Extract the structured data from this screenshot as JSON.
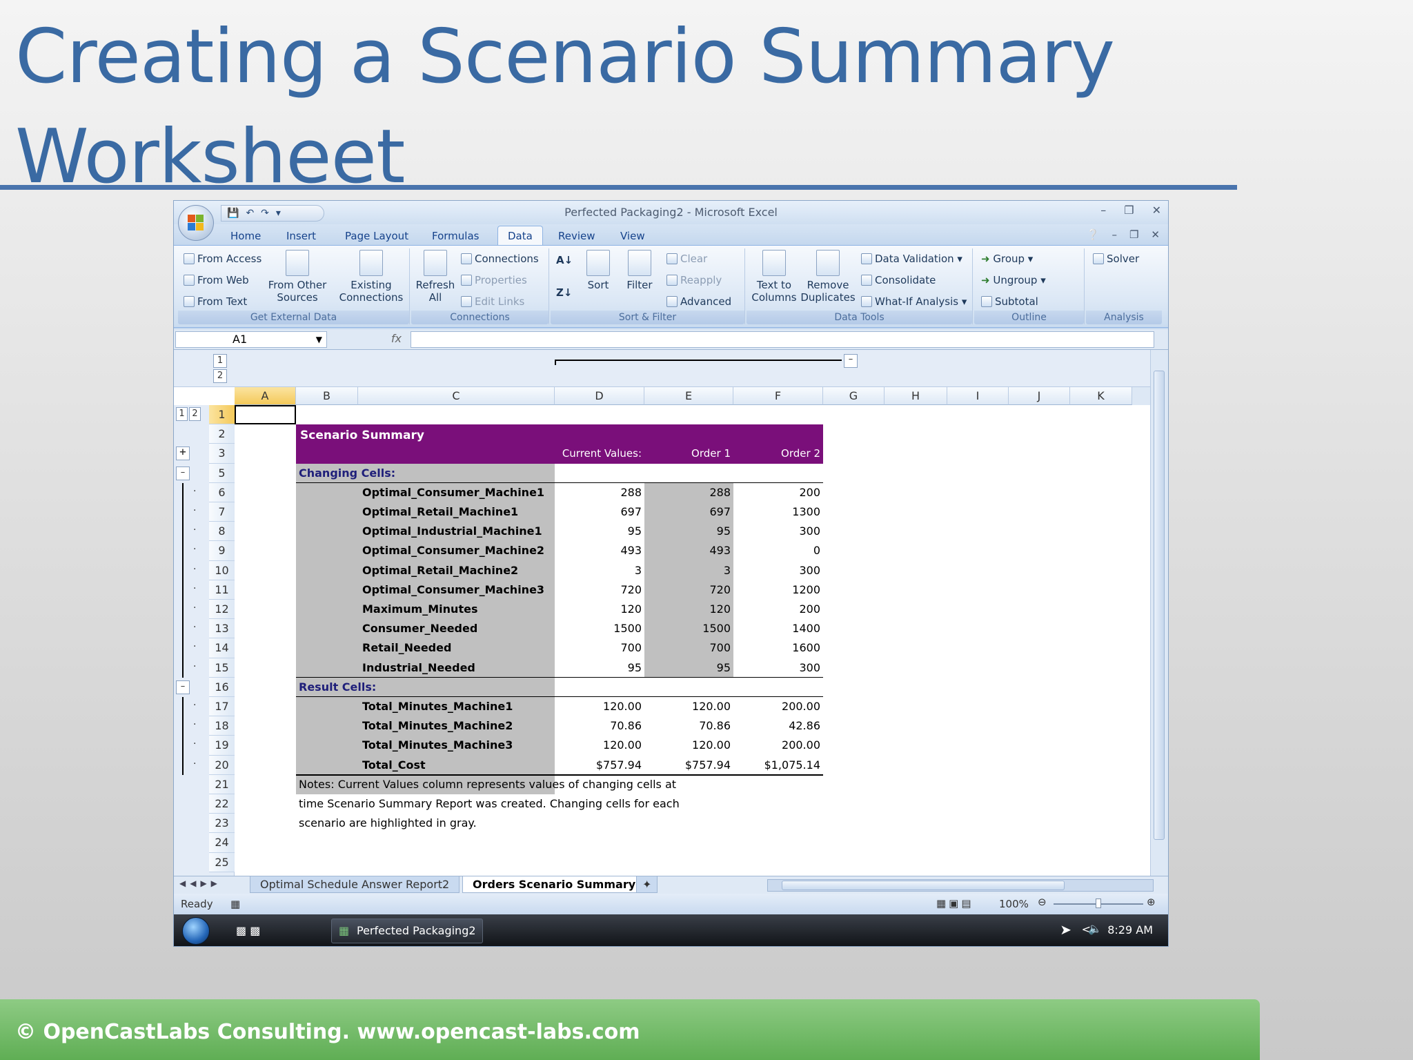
{
  "slide": {
    "title": "Creating a Scenario Summary Worksheet",
    "footer": "© OpenCastLabs Consulting. www.opencast-labs.com"
  },
  "excel": {
    "window_title": "Perfected Packaging2 - Microsoft Excel",
    "tabs": [
      "Home",
      "Insert",
      "Page Layout",
      "Formulas",
      "Data",
      "Review",
      "View"
    ],
    "active_tab": "Data",
    "ribbon": {
      "get_external": {
        "label": "Get External Data",
        "from_access": "From Access",
        "from_web": "From Web",
        "from_text": "From Text",
        "from_other": "From Other Sources",
        "existing": "Existing Connections"
      },
      "connections": {
        "label": "Connections",
        "refresh": "Refresh All",
        "connections": "Connections",
        "properties": "Properties",
        "edit_links": "Edit Links"
      },
      "sort_filter": {
        "label": "Sort & Filter",
        "sort": "Sort",
        "filter": "Filter",
        "clear": "Clear",
        "reapply": "Reapply",
        "advanced": "Advanced"
      },
      "data_tools": {
        "label": "Data Tools",
        "text_to_columns": "Text to Columns",
        "remove_duplicates": "Remove Duplicates",
        "data_validation": "Data Validation",
        "consolidate": "Consolidate",
        "what_if": "What-If Analysis"
      },
      "outline": {
        "label": "Outline",
        "group": "Group",
        "ungroup": "Ungroup",
        "subtotal": "Subtotal"
      },
      "analysis": {
        "label": "Analysis",
        "solver": "Solver"
      }
    },
    "name_box": "A1",
    "fx": "fx",
    "columns": [
      "A",
      "B",
      "C",
      "D",
      "E",
      "F",
      "G",
      "H",
      "I",
      "J",
      "K"
    ],
    "rows": [
      "1",
      "2",
      "3",
      "5",
      "6",
      "7",
      "8",
      "9",
      "10",
      "11",
      "12",
      "13",
      "14",
      "15",
      "16",
      "17",
      "18",
      "19",
      "20",
      "21",
      "22",
      "23",
      "24",
      "25"
    ],
    "summary": {
      "title": "Scenario Summary",
      "headers": [
        "Current Values:",
        "Order 1",
        "Order 2"
      ],
      "changing_label": "Changing Cells:",
      "result_label": "Result Cells:",
      "changing": [
        {
          "name": "Optimal_Consumer_Machine1",
          "v": [
            "288",
            "288",
            "200"
          ]
        },
        {
          "name": "Optimal_Retail_Machine1",
          "v": [
            "697",
            "697",
            "1300"
          ]
        },
        {
          "name": "Optimal_Industrial_Machine1",
          "v": [
            "95",
            "95",
            "300"
          ]
        },
        {
          "name": "Optimal_Consumer_Machine2",
          "v": [
            "493",
            "493",
            "0"
          ]
        },
        {
          "name": "Optimal_Retail_Machine2",
          "v": [
            "3",
            "3",
            "300"
          ]
        },
        {
          "name": "Optimal_Consumer_Machine3",
          "v": [
            "720",
            "720",
            "1200"
          ]
        },
        {
          "name": "Maximum_Minutes",
          "v": [
            "120",
            "120",
            "200"
          ]
        },
        {
          "name": "Consumer_Needed",
          "v": [
            "1500",
            "1500",
            "1400"
          ]
        },
        {
          "name": "Retail_Needed",
          "v": [
            "700",
            "700",
            "1600"
          ]
        },
        {
          "name": "Industrial_Needed",
          "v": [
            "95",
            "95",
            "300"
          ]
        }
      ],
      "results": [
        {
          "name": "Total_Minutes_Machine1",
          "v": [
            "120.00",
            "120.00",
            "200.00"
          ]
        },
        {
          "name": "Total_Minutes_Machine2",
          "v": [
            "70.86",
            "70.86",
            "42.86"
          ]
        },
        {
          "name": "Total_Minutes_Machine3",
          "v": [
            "120.00",
            "120.00",
            "200.00"
          ]
        },
        {
          "name": "Total_Cost",
          "v": [
            "$757.94",
            "$757.94",
            "$1,075.14"
          ]
        }
      ],
      "notes": [
        "Notes:  Current Values column represents values of changing cells at",
        "time Scenario Summary Report was created.  Changing cells for each",
        "scenario are highlighted in gray."
      ]
    },
    "sheet_tabs": [
      "Optimal Schedule Answer Report2",
      "Orders Scenario Summary"
    ],
    "status": "Ready",
    "zoom": "100%",
    "taskbar_item": "Perfected Packaging2",
    "clock": "8:29 AM"
  }
}
